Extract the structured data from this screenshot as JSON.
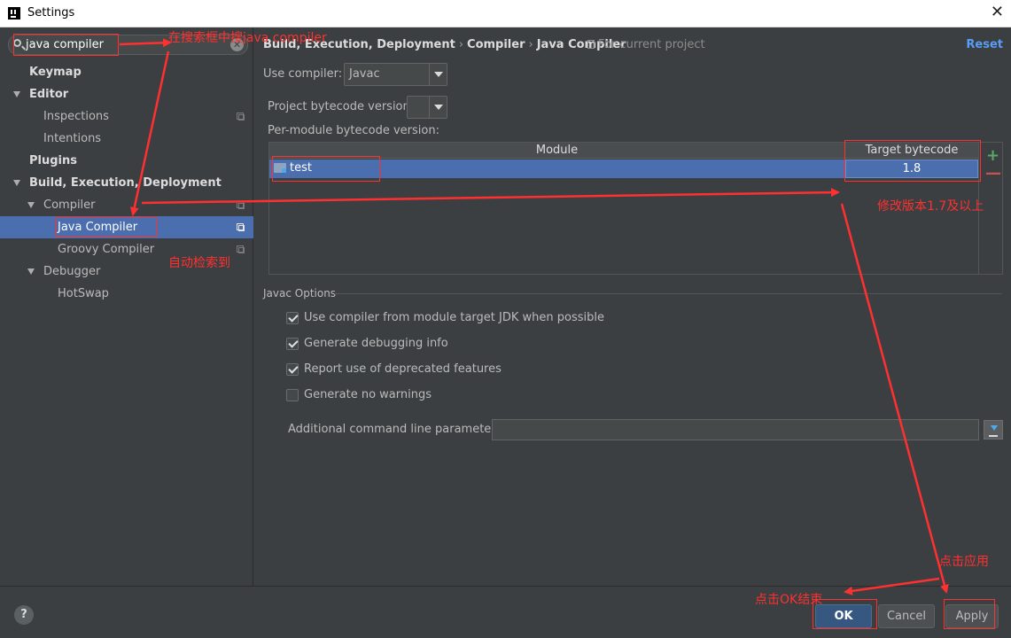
{
  "window": {
    "title": "Settings",
    "close_glyph": "✕"
  },
  "sidebar": {
    "search_value": "java compiler",
    "items": [
      {
        "label": "Keymap",
        "bold": true
      },
      {
        "label": "Editor",
        "bold": true
      },
      {
        "label": "Inspections"
      },
      {
        "label": "Intentions"
      },
      {
        "label": "Plugins",
        "bold": true
      },
      {
        "label": "Build, Execution, Deployment",
        "bold": true
      },
      {
        "label": "Compiler"
      },
      {
        "label": "Java Compiler",
        "selected": true
      },
      {
        "label": "Groovy Compiler"
      },
      {
        "label": "Debugger"
      },
      {
        "label": "HotSwap"
      }
    ]
  },
  "breadcrumb": {
    "part1": "Build, Execution, Deployment",
    "part2": "Compiler",
    "part3": "Java Compiler",
    "sep": "›",
    "scope": "For current project"
  },
  "reset_label": "Reset",
  "use_compiler": {
    "label": "Use compiler:",
    "value": "Javac"
  },
  "project_bytecode": {
    "label": "Project bytecode version:",
    "value": ""
  },
  "per_module_label": "Per-module bytecode version:",
  "module_table": {
    "headers": {
      "module": "Module",
      "target": "Target bytecode version"
    },
    "rows": [
      {
        "module": "test",
        "target": "1.8"
      }
    ],
    "add_glyph": "+",
    "remove_glyph": "—"
  },
  "javac_options": {
    "title": "Javac Options",
    "checkboxes": [
      {
        "label": "Use compiler from module target JDK when possible",
        "checked": true
      },
      {
        "label": "Generate debugging info",
        "checked": true
      },
      {
        "label": "Report use of deprecated features",
        "checked": true
      },
      {
        "label": "Generate no warnings",
        "checked": false
      }
    ],
    "params_label": "Additional command line parameters:",
    "params_value": ""
  },
  "buttons": {
    "help": "?",
    "ok": "OK",
    "cancel": "Cancel",
    "apply": "Apply"
  },
  "annotations": {
    "search_hint": "在搜索框中搜java compiler",
    "auto_found": "自动检索到",
    "change_version": "修改版本1.7及以上",
    "click_apply": "点击应用",
    "click_ok": "点击OK结束",
    "color": "#ff3030"
  }
}
